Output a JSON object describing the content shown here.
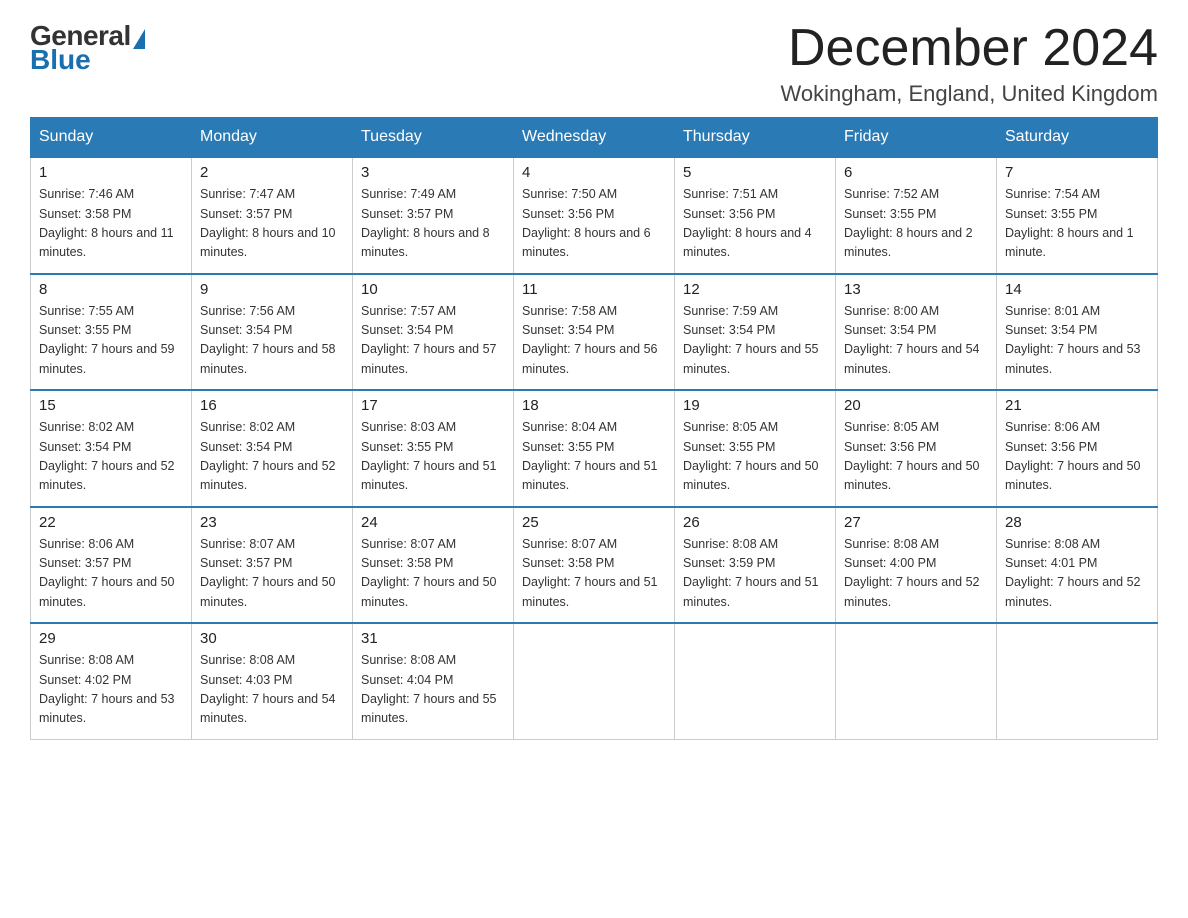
{
  "header": {
    "logo_general": "General",
    "logo_blue": "Blue",
    "month_title": "December 2024",
    "location": "Wokingham, England, United Kingdom"
  },
  "weekdays": [
    "Sunday",
    "Monday",
    "Tuesday",
    "Wednesday",
    "Thursday",
    "Friday",
    "Saturday"
  ],
  "weeks": [
    [
      {
        "day": "1",
        "sunrise": "7:46 AM",
        "sunset": "3:58 PM",
        "daylight": "8 hours and 11 minutes."
      },
      {
        "day": "2",
        "sunrise": "7:47 AM",
        "sunset": "3:57 PM",
        "daylight": "8 hours and 10 minutes."
      },
      {
        "day": "3",
        "sunrise": "7:49 AM",
        "sunset": "3:57 PM",
        "daylight": "8 hours and 8 minutes."
      },
      {
        "day": "4",
        "sunrise": "7:50 AM",
        "sunset": "3:56 PM",
        "daylight": "8 hours and 6 minutes."
      },
      {
        "day": "5",
        "sunrise": "7:51 AM",
        "sunset": "3:56 PM",
        "daylight": "8 hours and 4 minutes."
      },
      {
        "day": "6",
        "sunrise": "7:52 AM",
        "sunset": "3:55 PM",
        "daylight": "8 hours and 2 minutes."
      },
      {
        "day": "7",
        "sunrise": "7:54 AM",
        "sunset": "3:55 PM",
        "daylight": "8 hours and 1 minute."
      }
    ],
    [
      {
        "day": "8",
        "sunrise": "7:55 AM",
        "sunset": "3:55 PM",
        "daylight": "7 hours and 59 minutes."
      },
      {
        "day": "9",
        "sunrise": "7:56 AM",
        "sunset": "3:54 PM",
        "daylight": "7 hours and 58 minutes."
      },
      {
        "day": "10",
        "sunrise": "7:57 AM",
        "sunset": "3:54 PM",
        "daylight": "7 hours and 57 minutes."
      },
      {
        "day": "11",
        "sunrise": "7:58 AM",
        "sunset": "3:54 PM",
        "daylight": "7 hours and 56 minutes."
      },
      {
        "day": "12",
        "sunrise": "7:59 AM",
        "sunset": "3:54 PM",
        "daylight": "7 hours and 55 minutes."
      },
      {
        "day": "13",
        "sunrise": "8:00 AM",
        "sunset": "3:54 PM",
        "daylight": "7 hours and 54 minutes."
      },
      {
        "day": "14",
        "sunrise": "8:01 AM",
        "sunset": "3:54 PM",
        "daylight": "7 hours and 53 minutes."
      }
    ],
    [
      {
        "day": "15",
        "sunrise": "8:02 AM",
        "sunset": "3:54 PM",
        "daylight": "7 hours and 52 minutes."
      },
      {
        "day": "16",
        "sunrise": "8:02 AM",
        "sunset": "3:54 PM",
        "daylight": "7 hours and 52 minutes."
      },
      {
        "day": "17",
        "sunrise": "8:03 AM",
        "sunset": "3:55 PM",
        "daylight": "7 hours and 51 minutes."
      },
      {
        "day": "18",
        "sunrise": "8:04 AM",
        "sunset": "3:55 PM",
        "daylight": "7 hours and 51 minutes."
      },
      {
        "day": "19",
        "sunrise": "8:05 AM",
        "sunset": "3:55 PM",
        "daylight": "7 hours and 50 minutes."
      },
      {
        "day": "20",
        "sunrise": "8:05 AM",
        "sunset": "3:56 PM",
        "daylight": "7 hours and 50 minutes."
      },
      {
        "day": "21",
        "sunrise": "8:06 AM",
        "sunset": "3:56 PM",
        "daylight": "7 hours and 50 minutes."
      }
    ],
    [
      {
        "day": "22",
        "sunrise": "8:06 AM",
        "sunset": "3:57 PM",
        "daylight": "7 hours and 50 minutes."
      },
      {
        "day": "23",
        "sunrise": "8:07 AM",
        "sunset": "3:57 PM",
        "daylight": "7 hours and 50 minutes."
      },
      {
        "day": "24",
        "sunrise": "8:07 AM",
        "sunset": "3:58 PM",
        "daylight": "7 hours and 50 minutes."
      },
      {
        "day": "25",
        "sunrise": "8:07 AM",
        "sunset": "3:58 PM",
        "daylight": "7 hours and 51 minutes."
      },
      {
        "day": "26",
        "sunrise": "8:08 AM",
        "sunset": "3:59 PM",
        "daylight": "7 hours and 51 minutes."
      },
      {
        "day": "27",
        "sunrise": "8:08 AM",
        "sunset": "4:00 PM",
        "daylight": "7 hours and 52 minutes."
      },
      {
        "day": "28",
        "sunrise": "8:08 AM",
        "sunset": "4:01 PM",
        "daylight": "7 hours and 52 minutes."
      }
    ],
    [
      {
        "day": "29",
        "sunrise": "8:08 AM",
        "sunset": "4:02 PM",
        "daylight": "7 hours and 53 minutes."
      },
      {
        "day": "30",
        "sunrise": "8:08 AM",
        "sunset": "4:03 PM",
        "daylight": "7 hours and 54 minutes."
      },
      {
        "day": "31",
        "sunrise": "8:08 AM",
        "sunset": "4:04 PM",
        "daylight": "7 hours and 55 minutes."
      },
      null,
      null,
      null,
      null
    ]
  ]
}
